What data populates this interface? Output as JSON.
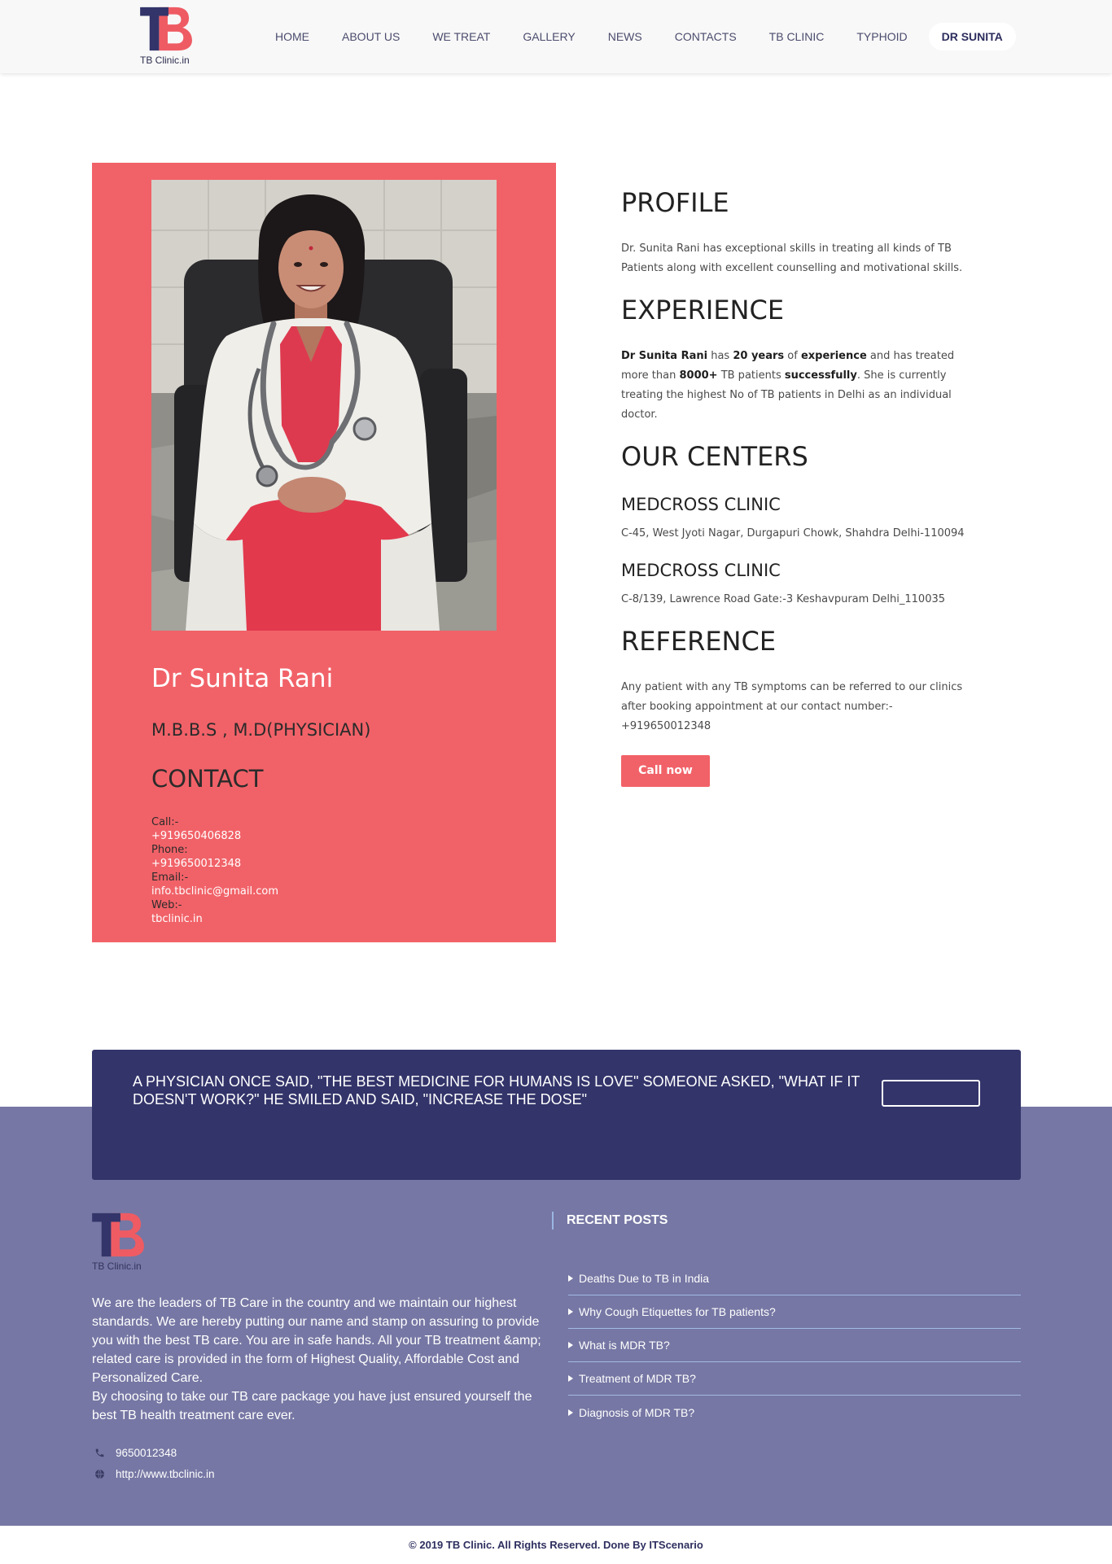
{
  "header": {
    "logo": {
      "mark": "TB",
      "caption": "TB Clinic.in"
    },
    "nav": [
      {
        "label": "HOME"
      },
      {
        "label": "ABOUT US"
      },
      {
        "label": "WE TREAT"
      },
      {
        "label": "GALLERY"
      },
      {
        "label": "NEWS"
      },
      {
        "label": "CONTACTS"
      },
      {
        "label": "TB CLINIC"
      },
      {
        "label": "TYPHOID"
      },
      {
        "label": "DR SUNITA",
        "active": true
      }
    ]
  },
  "doctor_card": {
    "name": "Dr Sunita Rani",
    "qualification": "M.B.B.S , M.D(PHYSICIAN)",
    "contact_heading": "CONTACT",
    "contacts": [
      {
        "label": "Call:-",
        "value": "+919650406828"
      },
      {
        "label": "Phone:",
        "value": "+919650012348"
      },
      {
        "label": "Email:-",
        "value": "info.tbclinic@gmail.com"
      },
      {
        "label": "Web:-",
        "value": "tbclinic.in"
      }
    ]
  },
  "details": {
    "profile": {
      "heading": "PROFILE",
      "text": "Dr. Sunita Rani has exceptional skills in treating all kinds of TB Patients along with excellent counselling and motivational skills."
    },
    "experience": {
      "heading": "EXPERIENCE",
      "segments": [
        {
          "text": "Dr Sunita Rani",
          "bold": true
        },
        {
          "text": " has "
        },
        {
          "text": "20 years",
          "bold": true
        },
        {
          "text": " of "
        },
        {
          "text": "experience",
          "bold": true
        },
        {
          "text": " and has treated more than "
        },
        {
          "text": "8000+",
          "bold": true
        },
        {
          "text": " TB patients "
        },
        {
          "text": "successfully",
          "bold": true
        },
        {
          "text": ". She is currently treating the highest No of TB patients in Delhi as an individual doctor."
        }
      ]
    },
    "centers": {
      "heading": "OUR CENTERS",
      "items": [
        {
          "name": "MEDCROSS CLINIC",
          "address": "C-45, West Jyoti Nagar, Durgapuri Chowk, Shahdra Delhi-110094"
        },
        {
          "name": "MEDCROSS CLINIC",
          "address": "C-8/139, Lawrence Road Gate:-3 Keshavpuram Delhi_110035"
        }
      ]
    },
    "reference": {
      "heading": "REFERENCE",
      "text": "Any patient with any TB symptoms can be referred to our clinics after booking appointment at our contact number:- +919650012348"
    },
    "call_button": "Call now"
  },
  "quote_banner": {
    "text": "A PHYSICIAN ONCE SAID, \"THE BEST MEDICINE FOR HUMANS IS LOVE\" SOMEONE ASKED, \"WHAT IF IT DOESN'T WORK?\" HE SMILED AND SAID, \"INCREASE THE DOSE\""
  },
  "footer": {
    "logo": {
      "mark": "TB",
      "caption": "TB Clinic.in"
    },
    "about": [
      "We are the leaders of TB Care in the country and we maintain our highest standards. We are hereby putting our name and stamp on assuring to provide you with the best TB care. You are in safe hands. All your TB treatment &amp; related care is provided in the form of Highest Quality, Affordable Cost and Personalized Care.",
      "By choosing to take our TB care package you have just ensured yourself the best TB health treatment care ever."
    ],
    "contact": {
      "phone": "9650012348",
      "website": "http://www.tbclinic.in"
    },
    "recent_posts": {
      "heading": "RECENT POSTS",
      "items": [
        "Deaths Due to TB in India",
        "Why Cough Etiquettes for TB patients?",
        "What is MDR TB?",
        "Treatment of MDR TB?",
        "Diagnosis of MDR TB?"
      ]
    },
    "copyright": "© 2019 TB Clinic. All Rights Reserved. Done By ITScenario"
  },
  "icons": {
    "logo": "tb-logo-mark",
    "phone": "phone-icon",
    "website": "globe-icon",
    "post_bullet": "triangle-right-icon"
  },
  "colors": {
    "accent": "#f16268",
    "navy": "#33346a",
    "footer_bg": "#7677a4",
    "header_bg": "#f8f8f8"
  }
}
